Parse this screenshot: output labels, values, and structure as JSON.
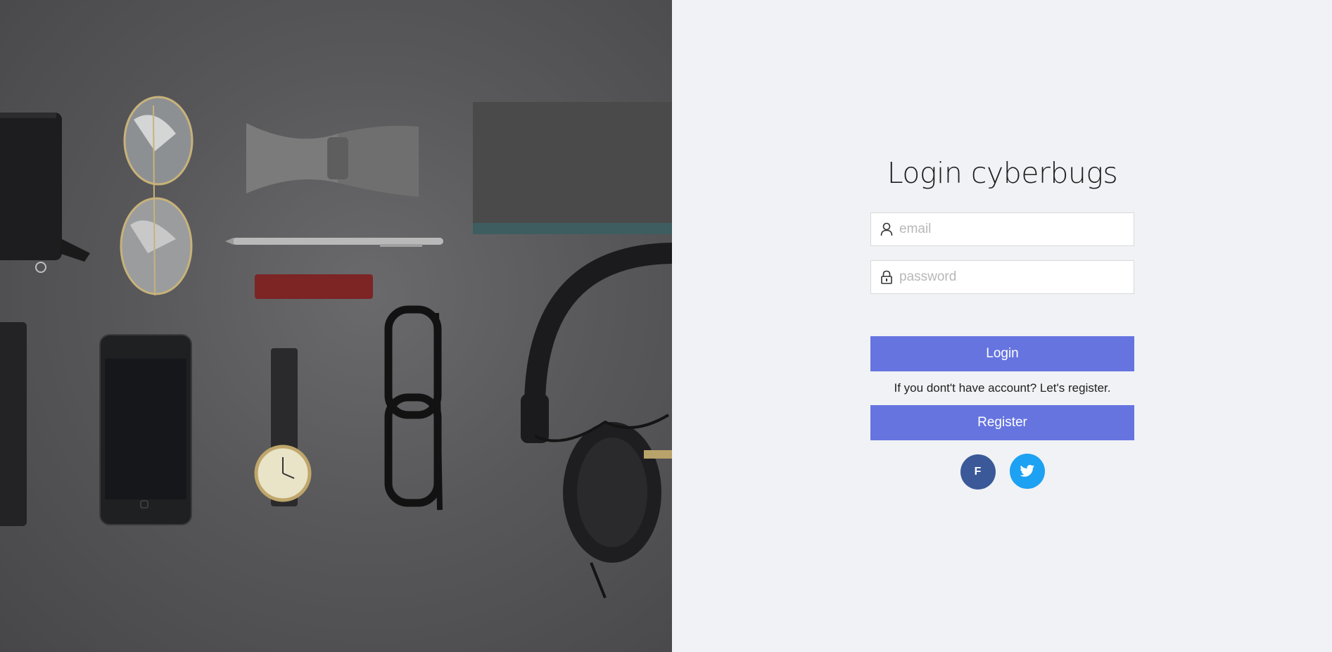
{
  "login": {
    "title": "Login cyberbugs",
    "email_placeholder": "email",
    "password_placeholder": "password",
    "login_label": "Login",
    "register_hint": "If you dont't have account? Let's register.",
    "register_label": "Register"
  },
  "social": {
    "facebook_label": "F",
    "facebook_color": "#3b5998",
    "twitter_color": "#1da1f2"
  },
  "icons": {
    "email": "user-icon",
    "password": "lock-icon",
    "twitter": "twitter-bird-icon"
  },
  "colors": {
    "button": "#6674e0",
    "panel_background": "#f0f2f5",
    "hero_background": "#58585a"
  }
}
